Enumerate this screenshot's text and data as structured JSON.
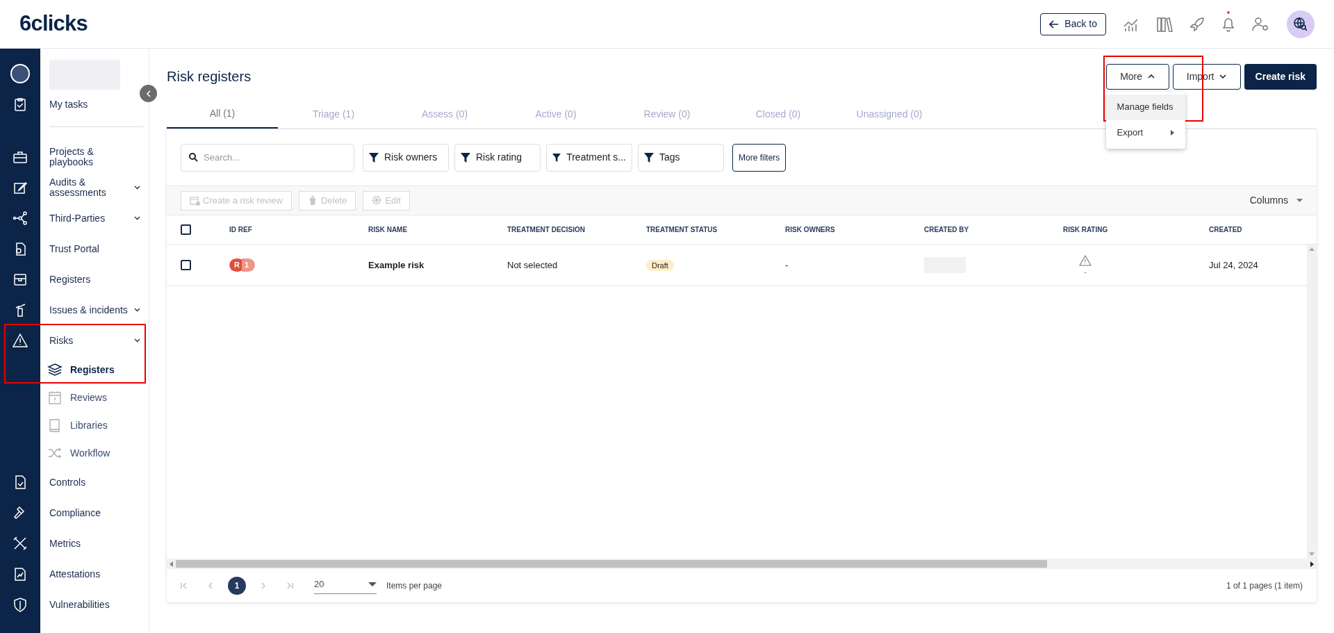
{
  "header": {
    "logo": "6clicks",
    "back_button": "Back to",
    "notification": true
  },
  "sidebar": {
    "items": [
      {
        "kind": "item",
        "label": "My tasks",
        "expandable": false,
        "selected": false
      },
      {
        "kind": "divider"
      },
      {
        "kind": "item",
        "label": "Projects & playbooks",
        "expandable": false,
        "selected": false
      },
      {
        "kind": "item",
        "label": "Audits & assessments",
        "expandable": true,
        "selected": false
      },
      {
        "kind": "item",
        "label": "Third-Parties",
        "expandable": true,
        "selected": false
      },
      {
        "kind": "item",
        "label": "Trust Portal",
        "expandable": false,
        "selected": false
      },
      {
        "kind": "item",
        "label": "Registers",
        "expandable": false,
        "selected": false
      },
      {
        "kind": "item",
        "label": "Issues & incidents",
        "expandable": true,
        "selected": false
      },
      {
        "kind": "item",
        "label": "Risks",
        "expandable": true,
        "selected": false
      },
      {
        "kind": "sub",
        "label": "Registers",
        "selected": true
      },
      {
        "kind": "sub",
        "label": "Reviews",
        "selected": false
      },
      {
        "kind": "sub",
        "label": "Libraries",
        "selected": false
      },
      {
        "kind": "sub",
        "label": "Workflow",
        "selected": false
      },
      {
        "kind": "item",
        "label": "Controls",
        "expandable": false,
        "selected": false
      },
      {
        "kind": "item",
        "label": "Compliance",
        "expandable": false,
        "selected": false
      },
      {
        "kind": "item",
        "label": "Metrics",
        "expandable": false,
        "selected": false
      },
      {
        "kind": "item",
        "label": "Attestations",
        "expandable": false,
        "selected": false
      },
      {
        "kind": "item",
        "label": "Vulnerabilities",
        "expandable": false,
        "selected": false
      }
    ]
  },
  "page_title": "Risk registers",
  "actions": [
    {
      "label": "More",
      "kind": "menu",
      "expanded": true
    },
    {
      "label": "Import",
      "kind": "menu",
      "expanded": false
    },
    {
      "label": "Create risk",
      "kind": "primary"
    }
  ],
  "menu": [
    {
      "label": "Manage fields",
      "highlighted": true,
      "submenu": false
    },
    {
      "label": "Export",
      "highlighted": false,
      "submenu": true
    }
  ],
  "tabs": [
    {
      "label": "All (1)",
      "selected": true
    },
    {
      "label": "Triage (1)",
      "selected": false
    },
    {
      "label": "Assess (0)",
      "selected": false
    },
    {
      "label": "Active (0)",
      "selected": false
    },
    {
      "label": "Review (0)",
      "selected": false
    },
    {
      "label": "Closed (0)",
      "selected": false
    },
    {
      "label": "Unassigned (0)",
      "selected": false
    }
  ],
  "search": {
    "placeholder": "Search..."
  },
  "filters": [
    "Risk owners",
    "Risk rating",
    "Treatment s...",
    "Tags"
  ],
  "more_filters": "More filters",
  "toolbar": [
    {
      "label": "Create a risk review",
      "disabled": true
    },
    {
      "label": "Delete",
      "disabled": true
    },
    {
      "label": "Edit",
      "disabled": true
    }
  ],
  "columns_button": "Columns",
  "table": {
    "select_all_checked": false,
    "columns": [
      "ID REF",
      "RISK NAME",
      "TREATMENT DECISION",
      "TREATMENT STATUS",
      "RISK OWNERS",
      "CREATED BY",
      "RISK RATING",
      "CREATED"
    ],
    "rows": [
      {
        "checked": false,
        "id_prefix": "R",
        "id_number": "1",
        "name": "Example risk",
        "treatment_decision": "Not selected",
        "treatment_status": "Draft",
        "risk_owners": "-",
        "risk_rating": "-",
        "created": "Jul 24, 2024"
      }
    ]
  },
  "pagination": {
    "current_page": "1",
    "page_size": "20",
    "page_size_label": "Items per page",
    "summary": "1 of 1 pages (1 item)"
  }
}
